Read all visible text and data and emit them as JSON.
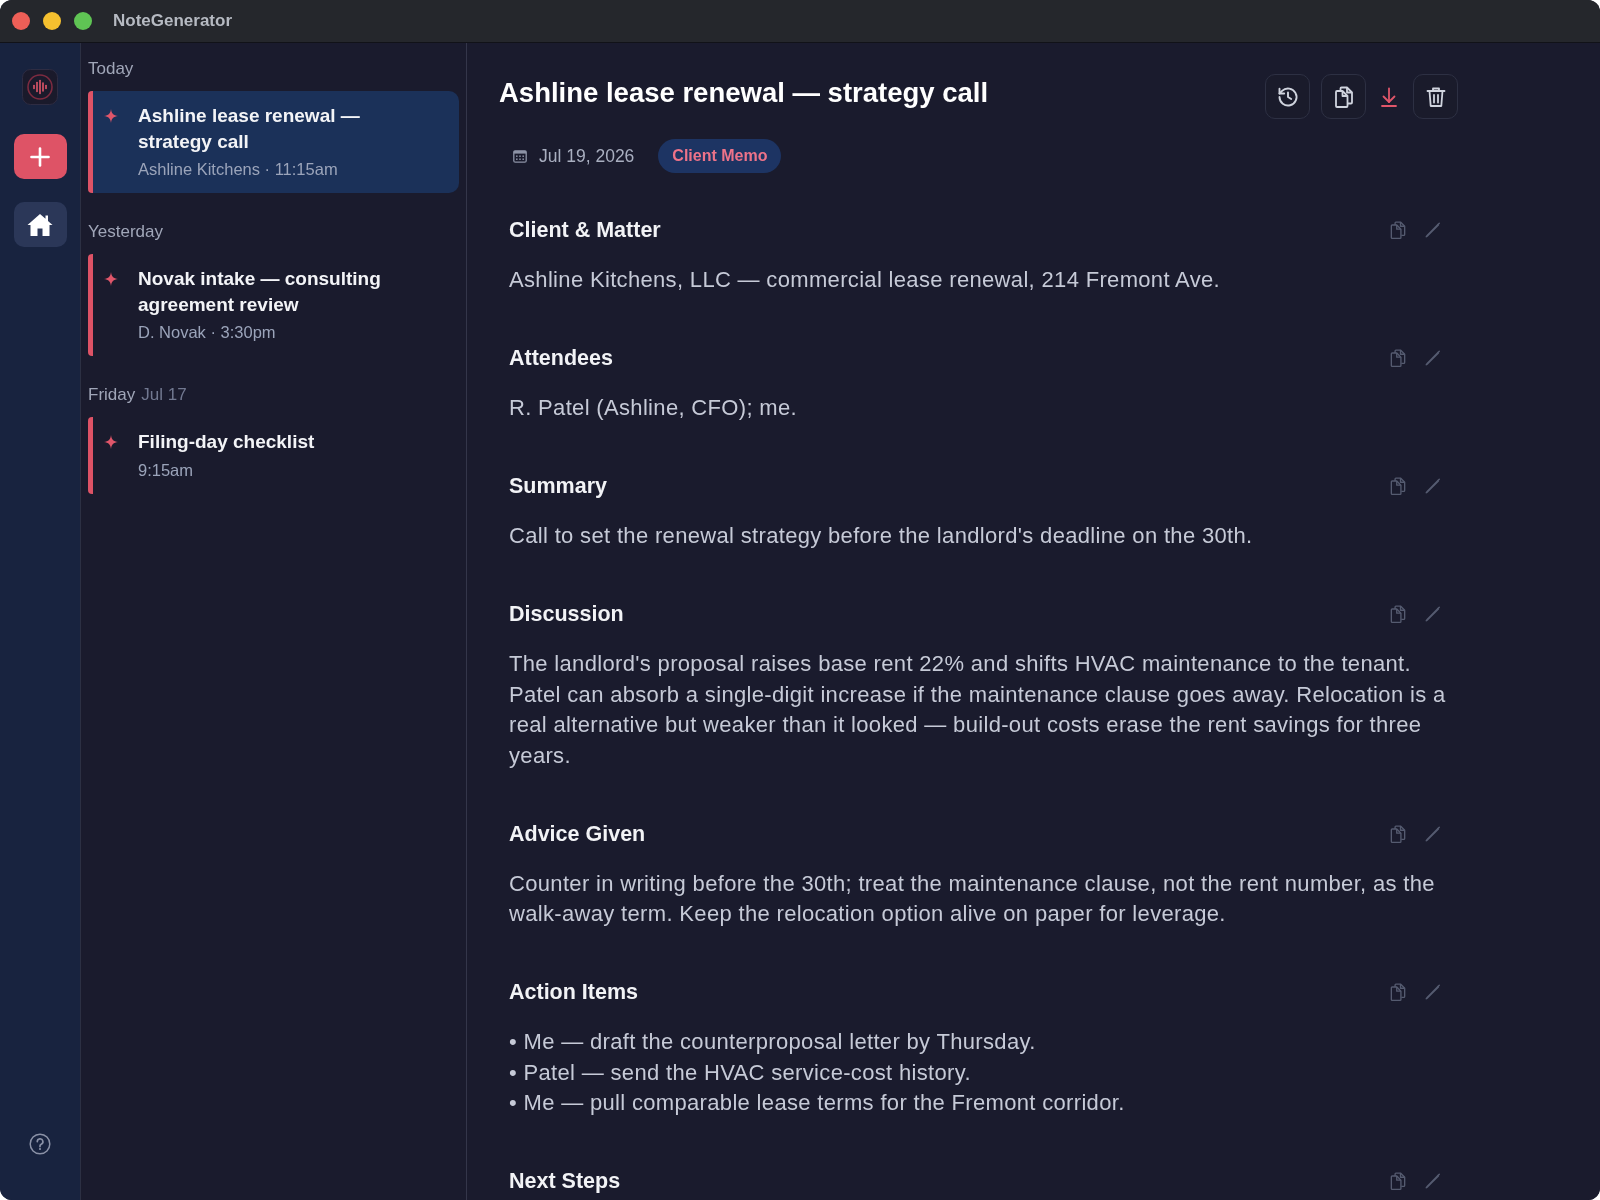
{
  "window": {
    "title": "NoteGenerator"
  },
  "rail": {
    "items": [
      {
        "kind": "home",
        "selected": true
      }
    ]
  },
  "note_groups": [
    {
      "label": "Today",
      "notes": [
        {
          "title": "Ashline lease renewal — strategy call",
          "meta": "Ashline Kitchens · 11:15am",
          "selected": true
        }
      ]
    },
    {
      "label": "Yesterday",
      "notes": [
        {
          "title": "Novak intake — consulting agreement review",
          "meta": "D. Novak · 3:30pm",
          "selected": false
        }
      ]
    },
    {
      "label": "Friday",
      "date": "Jul 17",
      "notes": [
        {
          "title": "Filing-day checklist",
          "meta": "9:15am",
          "selected": false
        }
      ]
    }
  ],
  "note": {
    "title": "Ashline lease renewal — strategy call",
    "date": "Jul 19, 2026",
    "tag": "Client Memo",
    "sections": [
      {
        "heading": "Client & Matter",
        "kind": "paragraph",
        "text": "Ashline Kitchens, LLC — commercial lease renewal, 214 Fremont Ave."
      },
      {
        "heading": "Attendees",
        "kind": "paragraph",
        "text": "R. Patel (Ashline, CFO); me."
      },
      {
        "heading": "Summary",
        "kind": "paragraph",
        "text": "Call to set the renewal strategy before the landlord's deadline on the 30th."
      },
      {
        "heading": "Discussion",
        "kind": "paragraph",
        "text": "The landlord's proposal raises base rent 22% and shifts HVAC maintenance to the tenant. Patel can absorb a single-digit increase if the maintenance clause goes away. Relocation is a real alternative but weaker than it looked — build-out costs erase the rent savings for three years."
      },
      {
        "heading": "Advice Given",
        "kind": "paragraph",
        "text": "Counter in writing before the 30th; treat the maintenance clause, not the rent number, as the walk-away term. Keep the relocation option alive on paper for leverage."
      },
      {
        "heading": "Action Items",
        "kind": "bullets",
        "items": [
          "• Me — draft the counterproposal letter by Thursday.",
          "• Patel — send the HVAC service-cost history.",
          "• Me — pull comparable lease terms for the Fremont corridor."
        ]
      },
      {
        "heading": "Next Steps"
      }
    ]
  }
}
